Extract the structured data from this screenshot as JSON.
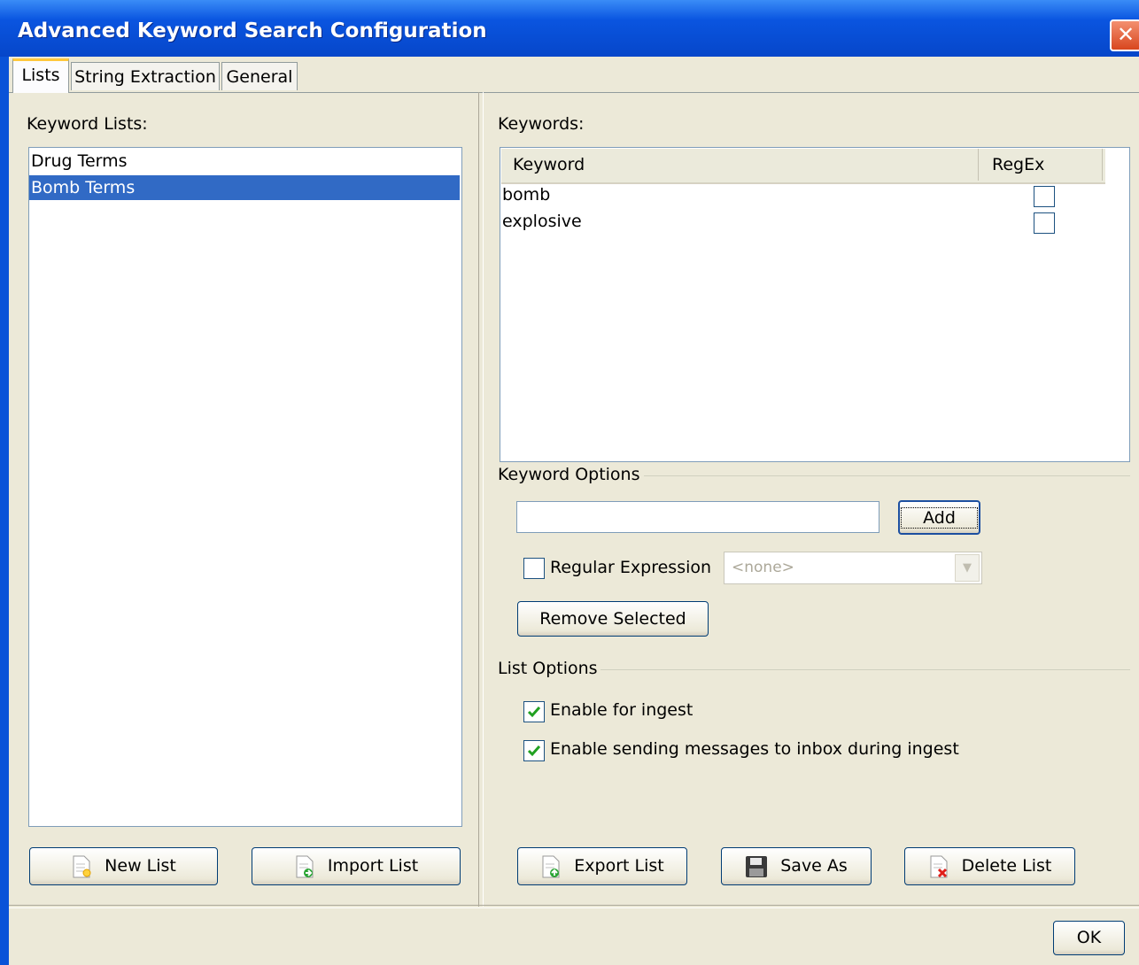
{
  "window": {
    "title": "Advanced Keyword Search Configuration"
  },
  "tabs": [
    {
      "label": "Lists",
      "active": true
    },
    {
      "label": "String Extraction",
      "active": false
    },
    {
      "label": "General",
      "active": false
    }
  ],
  "left": {
    "heading": "Keyword Lists:",
    "lists": [
      {
        "name": "Drug Terms",
        "selected": false
      },
      {
        "name": "Bomb Terms",
        "selected": true
      }
    ],
    "new_list": "New List",
    "import_list": "Import List"
  },
  "right": {
    "heading": "Keywords:",
    "columns": {
      "keyword": "Keyword",
      "regex": "RegEx"
    },
    "keywords": [
      {
        "keyword": "bomb",
        "regex": false
      },
      {
        "keyword": "explosive",
        "regex": false
      }
    ],
    "keyword_options": {
      "heading": "Keyword Options",
      "input_value": "",
      "add": "Add",
      "regex_label": "Regular Expression",
      "regex_checked": false,
      "select_value": "<none>",
      "remove_selected": "Remove Selected"
    },
    "list_options": {
      "heading": "List Options",
      "enable_ingest": "Enable for ingest",
      "enable_ingest_checked": true,
      "enable_messages": "Enable sending messages to inbox during ingest",
      "enable_messages_checked": true
    },
    "export_list": "Export List",
    "save_as": "Save As",
    "delete_list": "Delete List"
  },
  "footer": {
    "ok": "OK"
  },
  "colors": {
    "titlebar": "#0a55e0",
    "selection": "#316ac5",
    "check": "#21a121",
    "background": "#ece9d8"
  }
}
